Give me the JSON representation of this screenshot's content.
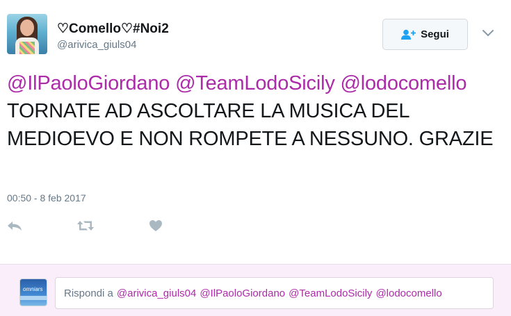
{
  "tweet": {
    "author_name": "♡Comello♡#Noi2",
    "author_handle": "@arivica_giuls04",
    "follow_label": "Segui",
    "mentions": [
      "@IlPaoloGiordano",
      "@TeamLodoSicily",
      "@lodocomello"
    ],
    "body": "TORNATE AD ASCOLTARE LA MUSICA DEL MEDIOEVO E NON ROMPETE A NESSUNO. GRAZIE",
    "timestamp": "00:50 - 8 feb 2017"
  },
  "actions": [
    {
      "icon": "reply-icon"
    },
    {
      "icon": "retweet-icon"
    },
    {
      "icon": "like-icon"
    }
  ],
  "reply_box": {
    "prefix": "Rispondi a",
    "mentions": [
      "@arivica_giuls04",
      "@IlPaoloGiordano",
      "@TeamLodoSicily",
      "@lodocomello"
    ],
    "avatar_text": "omniars"
  },
  "colors": {
    "mention": "#ab2ba8",
    "text": "#14171a",
    "muted": "#657786",
    "reply_background": "#f9eefa",
    "icon": "#aab8c2"
  }
}
